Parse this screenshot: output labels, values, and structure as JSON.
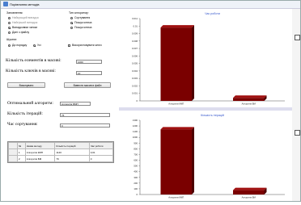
{
  "window": {
    "title": "Порівняння методів"
  },
  "left": {
    "sort_group": {
      "title": "Заповнення:",
      "options": [
        "Найкращий випадок",
        "Найгірший випадок",
        "Випадковим чином",
        "Дані з файлу"
      ],
      "selected": 2
    },
    "algo_group": {
      "title": "Тип алгоритму:",
      "options": [
        "Сортування",
        "Пошук ключа",
        "Пошук ключа"
      ],
      "selected": 1
    },
    "sort_order": {
      "title": "Шукати:",
      "options": [
        "Да порядку",
        "Усі"
      ],
      "selected": 1
    },
    "checkbox_label": "Використовувати ключ",
    "count_label": "Кількість елементів в масиві:",
    "count_value": "1000",
    "keys_label": "Кількість ключів в масиві:",
    "keys_value": "10",
    "btn_execute": "Виконувати",
    "btn_load": "Вивести масив в файл",
    "optimal_label": "Оптимальний алгоритм:",
    "optimal_value": "Алгоритм БМП",
    "iterations_label": "Кількість ітерацій:",
    "iterations_value": "76",
    "time_label": "Час сортування:",
    "time_value": "0"
  },
  "table": {
    "headers": [
      "№",
      "Назва методу",
      "Кількість ітерацій",
      "Час роботи"
    ],
    "rows": [
      [
        "1",
        "Алгоритм КМП",
        "1140",
        "0,01"
      ],
      [
        "2",
        "Алгоритм БМ",
        "76",
        "0"
      ]
    ]
  },
  "colors": {
    "bar": "#7a0000",
    "title_text": "#3355cc"
  },
  "chart_data": [
    {
      "type": "bar",
      "title": "Час роботи",
      "categories": [
        "Алгоритм КМП",
        "Алгоритм БМ"
      ],
      "values": [
        0.0098,
        0.0004
      ],
      "ylim": [
        0,
        0.011
      ],
      "ticks": [
        "0",
        "0.001",
        "0.002",
        "0.003",
        "0.004",
        "0.005",
        "0.006",
        "0.007",
        "0.008",
        "0.009",
        "0.01",
        "0.011"
      ],
      "xlabel": "",
      "ylabel": "",
      "grid": false
    },
    {
      "type": "bar",
      "title": "Кількість ітерацій",
      "categories": [
        "Алгоритм КМП",
        "Алгоритм БМ"
      ],
      "values": [
        1140,
        76
      ],
      "ylim": [
        0,
        1300
      ],
      "ticks": [
        "0",
        "100",
        "200",
        "300",
        "400",
        "500",
        "600",
        "700",
        "800",
        "900",
        "1000",
        "1100",
        "1200",
        "1300"
      ],
      "xlabel": "",
      "ylabel": "",
      "grid": false
    }
  ]
}
